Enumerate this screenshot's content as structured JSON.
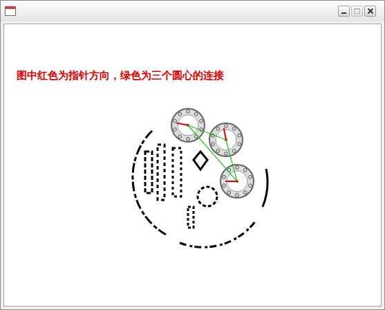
{
  "window": {
    "title": "",
    "controls": [
      {
        "name": "minimize",
        "disabled": false
      },
      {
        "name": "maximize",
        "disabled": true
      },
      {
        "name": "close",
        "disabled": false
      }
    ]
  },
  "caption": "图中红色为指针方向，绿色为三个圆心的连接",
  "dials": [
    {
      "level": 0.78
    },
    {
      "level": 0.97
    },
    {
      "level": 0.75
    }
  ]
}
